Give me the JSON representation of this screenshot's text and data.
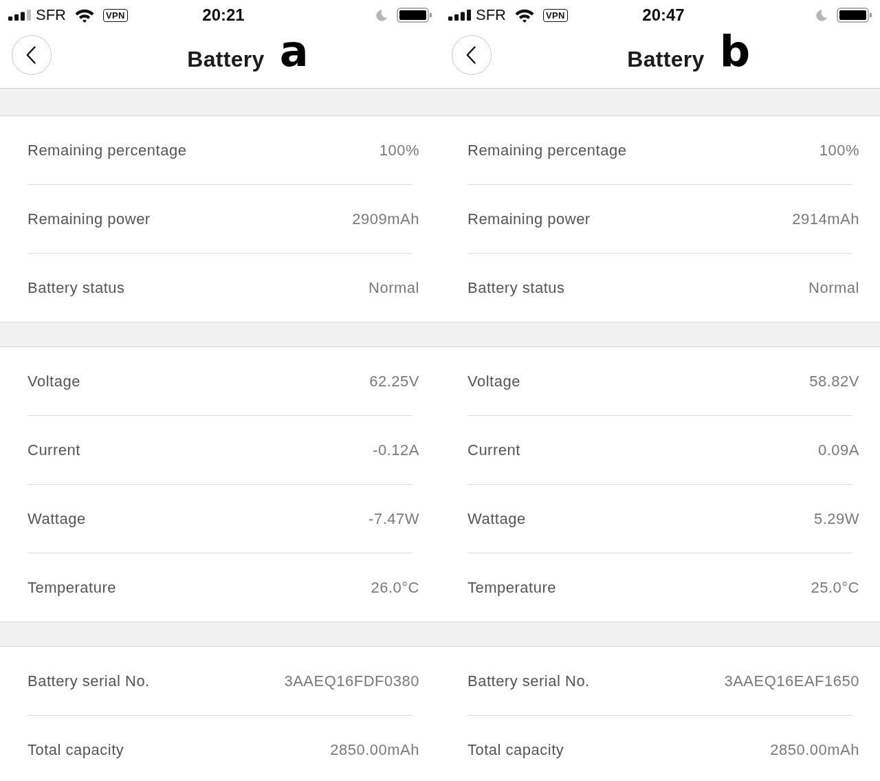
{
  "screens": [
    {
      "status_bar": {
        "full_signal": false,
        "carrier": "SFR",
        "vpn": "VPN",
        "time": "20:21"
      },
      "header": {
        "title": "Battery",
        "annotation": "a"
      },
      "sections": [
        {
          "rows": [
            {
              "label": "Remaining percentage",
              "value": "100%"
            },
            {
              "label": "Remaining power",
              "value": "2909mAh"
            },
            {
              "label": "Battery status",
              "value": "Normal"
            }
          ]
        },
        {
          "rows": [
            {
              "label": "Voltage",
              "value": "62.25V"
            },
            {
              "label": "Current",
              "value": "-0.12A"
            },
            {
              "label": "Wattage",
              "value": "-7.47W"
            },
            {
              "label": "Temperature",
              "value": "26.0°C"
            }
          ]
        },
        {
          "rows": [
            {
              "label": "Battery serial No.",
              "value": "3AAEQ16FDF0380"
            },
            {
              "label": "Total capacity",
              "value": "2850.00mAh"
            }
          ]
        }
      ]
    },
    {
      "status_bar": {
        "full_signal": true,
        "carrier": "SFR",
        "vpn": "VPN",
        "time": "20:47"
      },
      "header": {
        "title": "Battery",
        "annotation": "b"
      },
      "sections": [
        {
          "rows": [
            {
              "label": "Remaining percentage",
              "value": "100%"
            },
            {
              "label": "Remaining power",
              "value": "2914mAh"
            },
            {
              "label": "Battery status",
              "value": "Normal"
            }
          ]
        },
        {
          "rows": [
            {
              "label": "Voltage",
              "value": "58.82V"
            },
            {
              "label": "Current",
              "value": "0.09A"
            },
            {
              "label": "Wattage",
              "value": "5.29W"
            },
            {
              "label": "Temperature",
              "value": "25.0°C"
            }
          ]
        },
        {
          "rows": [
            {
              "label": "Battery serial No.",
              "value": "3AAEQ16EAF1650"
            },
            {
              "label": "Total capacity",
              "value": "2850.00mAh"
            }
          ]
        }
      ]
    }
  ]
}
